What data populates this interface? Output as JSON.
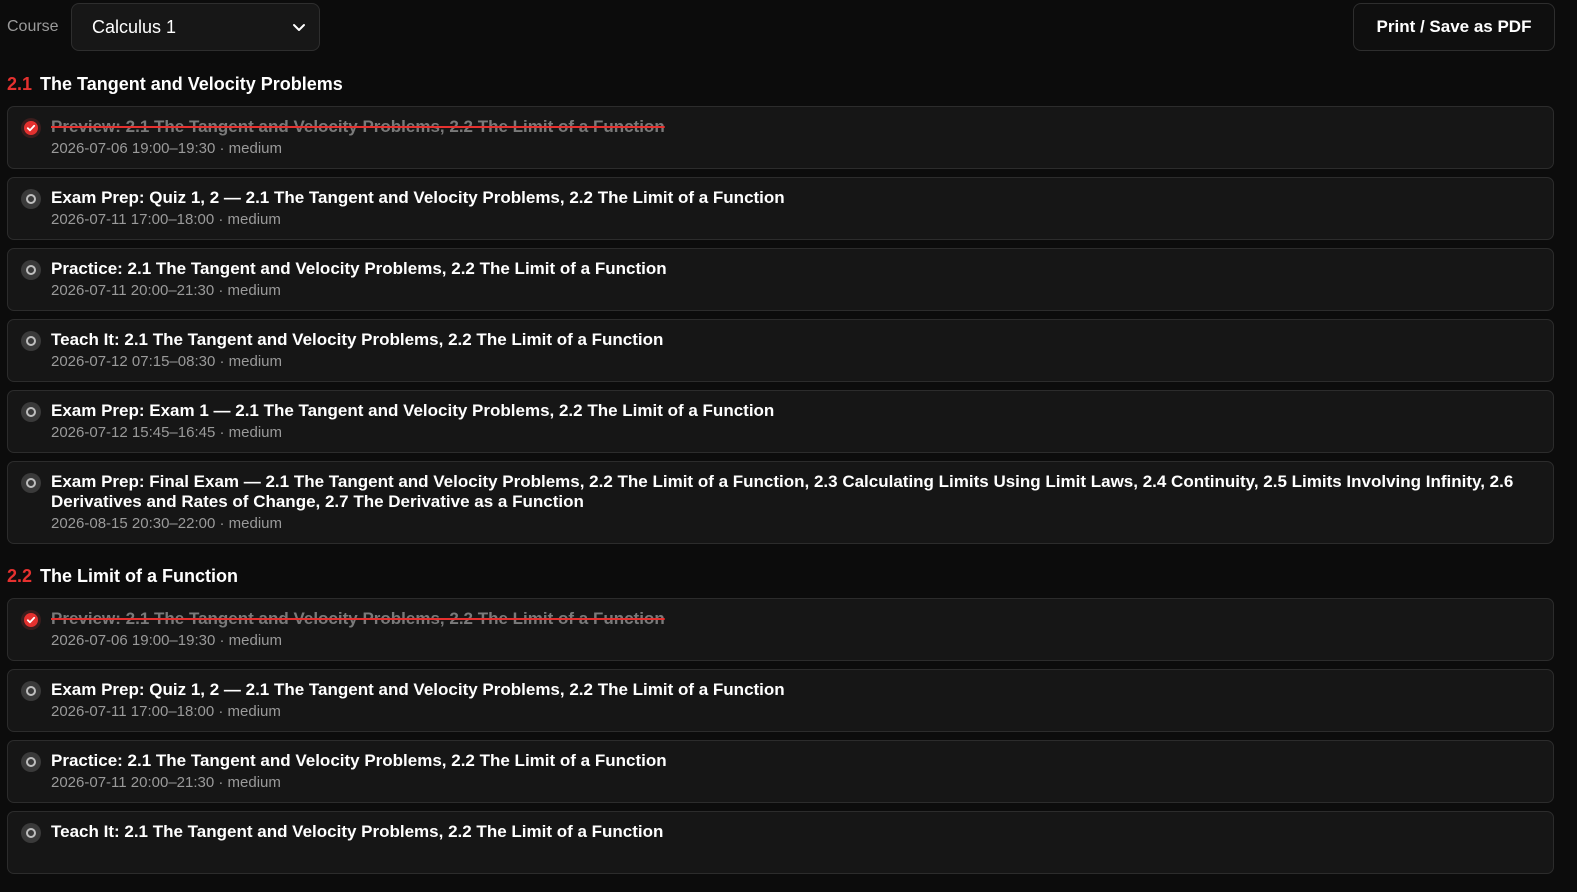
{
  "header": {
    "course_label": "Course",
    "course_value": "Calculus 1",
    "print_label": "Print / Save as PDF"
  },
  "sections": [
    {
      "num": "2.1",
      "title": "The Tangent and Velocity Problems",
      "items": [
        {
          "title": "Preview: 2.1 The Tangent and Velocity Problems, 2.2 The Limit of a Function",
          "meta": "2026-07-06 19:00–19:30 · medium",
          "done": true
        },
        {
          "title": "Exam Prep: Quiz 1, 2 — 2.1 The Tangent and Velocity Problems, 2.2 The Limit of a Function",
          "meta": "2026-07-11 17:00–18:00 · medium",
          "done": false
        },
        {
          "title": "Practice: 2.1 The Tangent and Velocity Problems, 2.2 The Limit of a Function",
          "meta": "2026-07-11 20:00–21:30 · medium",
          "done": false
        },
        {
          "title": "Teach It: 2.1 The Tangent and Velocity Problems, 2.2 The Limit of a Function",
          "meta": "2026-07-12 07:15–08:30 · medium",
          "done": false
        },
        {
          "title": "Exam Prep: Exam 1 — 2.1 The Tangent and Velocity Problems, 2.2 The Limit of a Function",
          "meta": "2026-07-12 15:45–16:45 · medium",
          "done": false
        },
        {
          "title": "Exam Prep: Final Exam — 2.1 The Tangent and Velocity Problems, 2.2 The Limit of a Function, 2.3 Calculating Limits Using Limit Laws, 2.4 Continuity, 2.5 Limits Involving Infinity, 2.6 Derivatives and Rates of Change, 2.7 The Derivative as a Function",
          "meta": "2026-08-15 20:30–22:00 · medium",
          "done": false
        }
      ]
    },
    {
      "num": "2.2",
      "title": "The Limit of a Function",
      "items": [
        {
          "title": "Preview: 2.1 The Tangent and Velocity Problems, 2.2 The Limit of a Function",
          "meta": "2026-07-06 19:00–19:30 · medium",
          "done": true
        },
        {
          "title": "Exam Prep: Quiz 1, 2 — 2.1 The Tangent and Velocity Problems, 2.2 The Limit of a Function",
          "meta": "2026-07-11 17:00–18:00 · medium",
          "done": false
        },
        {
          "title": "Practice: 2.1 The Tangent and Velocity Problems, 2.2 The Limit of a Function",
          "meta": "2026-07-11 20:00–21:30 · medium",
          "done": false
        },
        {
          "title": "Teach It: 2.1 The Tangent and Velocity Problems, 2.2 The Limit of a Function",
          "meta": "",
          "done": false
        }
      ]
    }
  ],
  "colors": {
    "accent": "#e5312f",
    "background": "#0c0c0c",
    "card": "#161616",
    "muted": "#9a9a9a"
  }
}
